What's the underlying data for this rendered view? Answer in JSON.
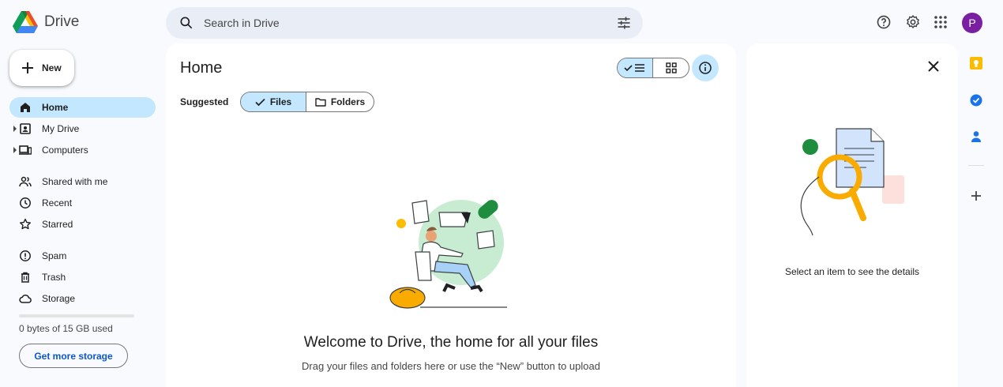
{
  "app": {
    "name": "Drive"
  },
  "search": {
    "placeholder": "Search in Drive"
  },
  "header": {
    "avatar_letter": "P",
    "icons": [
      "help-icon",
      "settings-icon",
      "apps-grid-icon"
    ]
  },
  "sidebar": {
    "new_label": "New",
    "items": [
      {
        "label": "Home",
        "icon": "home-icon",
        "active": true
      },
      {
        "label": "My Drive",
        "icon": "my-drive-icon",
        "expandable": true
      },
      {
        "label": "Computers",
        "icon": "computers-icon",
        "expandable": true
      },
      {
        "label": "Shared with me",
        "icon": "shared-icon"
      },
      {
        "label": "Recent",
        "icon": "clock-icon"
      },
      {
        "label": "Starred",
        "icon": "star-icon"
      },
      {
        "label": "Spam",
        "icon": "spam-icon"
      },
      {
        "label": "Trash",
        "icon": "trash-icon"
      },
      {
        "label": "Storage",
        "icon": "cloud-icon"
      }
    ],
    "storage_text": "0 bytes of 15 GB used",
    "storage_used_fraction": 0,
    "get_storage_label": "Get more storage"
  },
  "main": {
    "title": "Home",
    "suggested_label": "Suggested",
    "chips": {
      "files": "Files",
      "folders": "Folders"
    },
    "welcome_title": "Welcome to Drive, the home for all your files",
    "welcome_subtitle": "Drag your files and folders here or use the “New” button to upload"
  },
  "details": {
    "empty_message": "Select an item to see the details"
  },
  "colors": {
    "accent": "#c2e7ff",
    "link": "#0b57d0",
    "avatar": "#7b1fa2",
    "background": "#f8fafd"
  }
}
